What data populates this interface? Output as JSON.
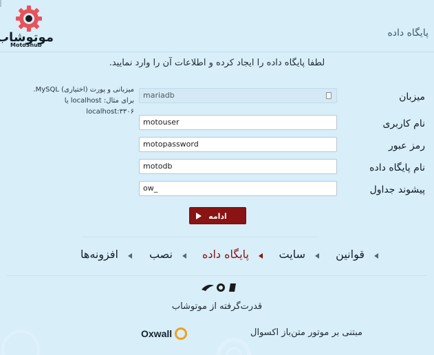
{
  "brand": {
    "name": "موتوشاب",
    "tagline": "MotoShub"
  },
  "header": {
    "title": "پایگاه داده"
  },
  "intro": "لطفا پایگاه داده را ایجاد کرده و اطلاعات آن را وارد نمایید.",
  "form": {
    "host": {
      "label": "میزبان",
      "value": "mariadb",
      "help_line1": "میزبانی و پورت (اختیاری) MySQL.",
      "help_line2": "برای مثال: localhost یا localhost:۳۳۰۶"
    },
    "user": {
      "label": "نام کاربری",
      "value": "motouser"
    },
    "password": {
      "label": "رمز عبور",
      "value": "motopassword"
    },
    "database": {
      "label": "نام پایگاه داده",
      "value": "motodb"
    },
    "prefix": {
      "label": "پیشوند جداول",
      "value": "ow_"
    },
    "submit_label": "ادامه"
  },
  "steps": [
    {
      "label": "قوانین",
      "active": false
    },
    {
      "label": "سایت",
      "active": false
    },
    {
      "label": "پایگاه داده",
      "active": true
    },
    {
      "label": "نصب",
      "active": false
    },
    {
      "label": "افزونه‌ها",
      "active": false
    }
  ],
  "footer": {
    "powered_by": "قدرت‌گرفته از موتوشاب",
    "based_on": "مبتنی بر موتور متن‌باز اکسوال",
    "oxwall_word": "Oxwall"
  },
  "colors": {
    "background": "#d8eef9",
    "accent": "#8a1313",
    "oxwall_orange": "#f29f19"
  }
}
